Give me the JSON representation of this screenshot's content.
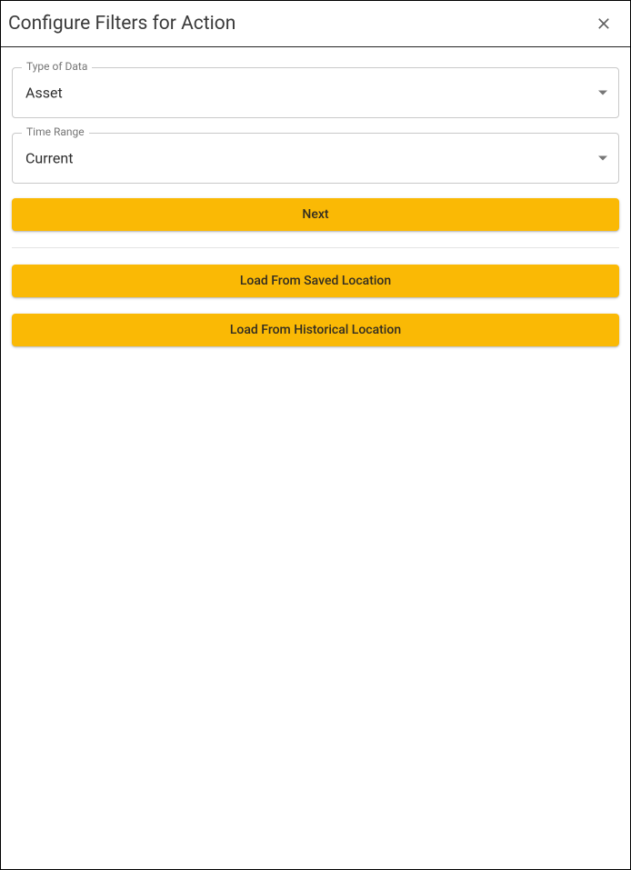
{
  "dialog": {
    "title": "Configure Filters for Action"
  },
  "fields": {
    "type_of_data": {
      "label": "Type of Data",
      "value": "Asset"
    },
    "time_range": {
      "label": "Time Range",
      "value": "Current"
    }
  },
  "buttons": {
    "next": "Next",
    "load_saved": "Load From Saved Location",
    "load_historical": "Load From Historical Location"
  },
  "colors": {
    "accent": "#fab905"
  }
}
